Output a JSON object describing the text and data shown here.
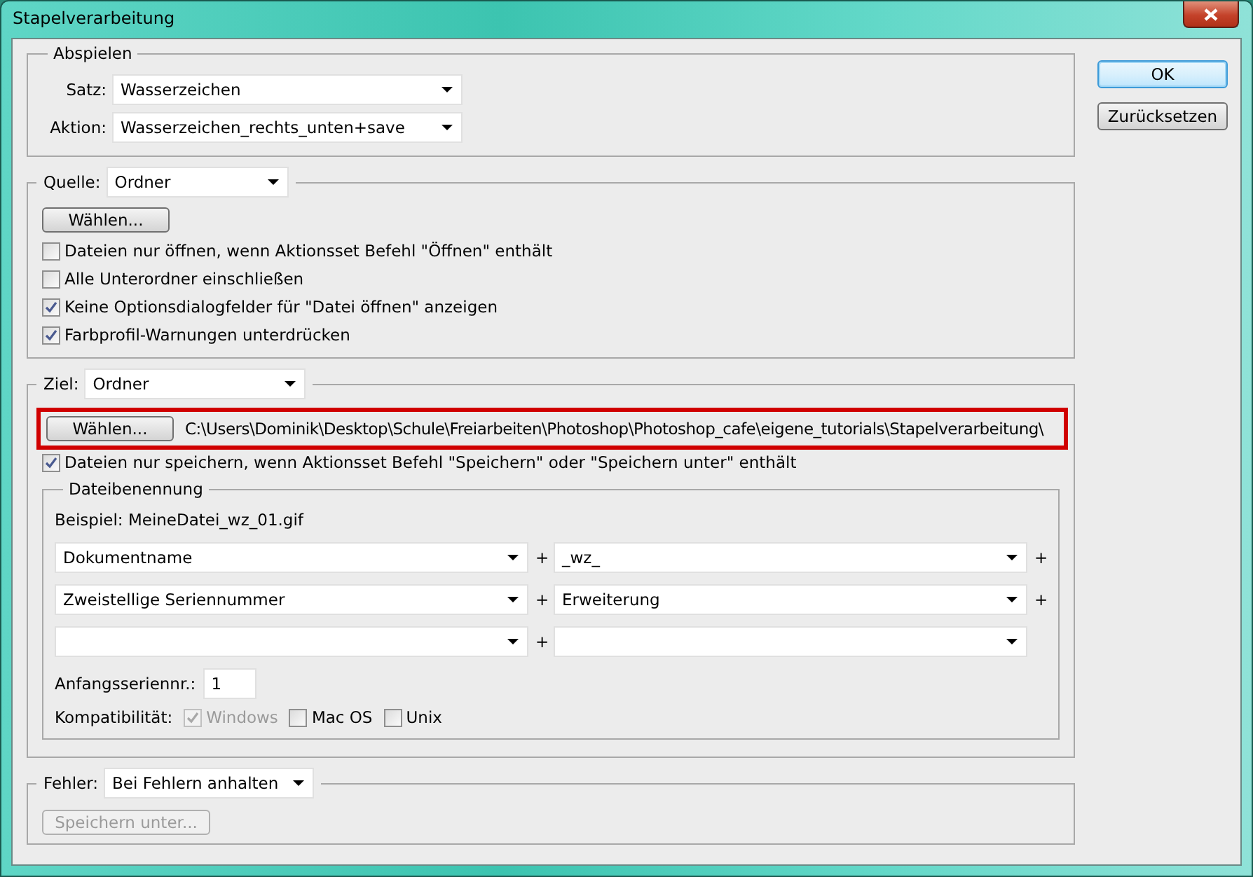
{
  "window": {
    "title": "Stapelverarbeitung"
  },
  "play": {
    "legend": "Abspielen",
    "fields": [
      {
        "label": "Satz:",
        "value": "Wasserzeichen"
      },
      {
        "label": "Aktion:",
        "value": "Wasserzeichen_rechts_unten+save"
      }
    ]
  },
  "source": {
    "label": "Quelle:",
    "value": "Ordner",
    "button": "Wählen...",
    "options": [
      {
        "label": "Dateien nur öffnen, wenn Aktionsset Befehl \"Öffnen\" enthält",
        "checked": false
      },
      {
        "label": "Alle Unterordner einschließen",
        "checked": false
      },
      {
        "label": "Keine Optionsdialogfelder für \"Datei öffnen\" anzeigen",
        "checked": true
      },
      {
        "label": "Farbprofil-Warnungen unterdrücken",
        "checked": true
      }
    ]
  },
  "target": {
    "label": "Ziel:",
    "value": "Ordner",
    "button": "Wählen...",
    "path": "C:\\Users\\Dominik\\Desktop\\Schule\\Freiarbeiten\\Photoshop\\Photoshop_cafe\\eigene_tutorials\\Stapelverarbeitung\\",
    "highlighted": true,
    "option": {
      "label": "Dateien nur speichern, wenn Aktionsset Befehl \"Speichern\" oder \"Speichern unter\" enthält",
      "checked": true
    },
    "naming": {
      "legend": "Dateibenennung",
      "example": "Beispiel: MeineDatei_wz_01.gif",
      "rows": [
        {
          "left": "Dokumentname",
          "joiner": "+",
          "right": "_wz_",
          "suffix": "+"
        },
        {
          "left": "Zweistellige Seriennummer",
          "joiner": "+",
          "right": "Erweiterung",
          "suffix": "+"
        },
        {
          "joiner": "+"
        }
      ],
      "start": {
        "label": "Anfangsseriennr.:",
        "value": "1"
      },
      "compat": {
        "label": "Kompatibilität:",
        "options": [
          {
            "label": "Windows",
            "checked": true,
            "disabled": true
          },
          {
            "label": "Mac OS",
            "checked": false,
            "disabled": false
          },
          {
            "label": "Unix",
            "checked": false,
            "disabled": false
          }
        ]
      }
    }
  },
  "error": {
    "label": "Fehler:",
    "value": "Bei Fehlern anhalten",
    "button": {
      "label": "Speichern unter...",
      "disabled": true
    }
  },
  "buttons": [
    {
      "label": "OK",
      "default": true
    },
    {
      "label": "Zurücksetzen",
      "default": false
    }
  ]
}
